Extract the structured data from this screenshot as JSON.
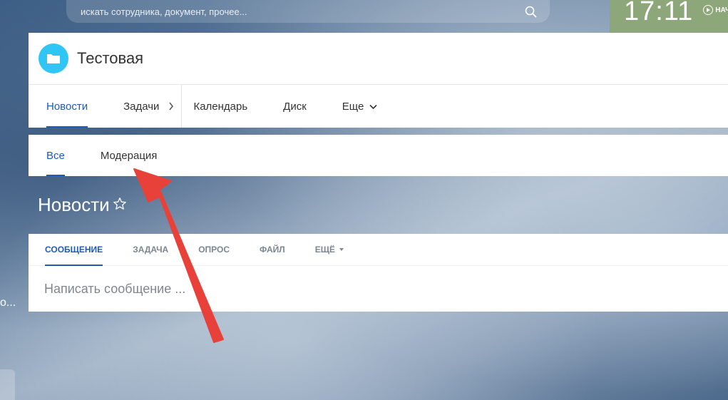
{
  "search": {
    "placeholder": "искать сотрудника, документ, прочее..."
  },
  "clock": {
    "time": "17:11",
    "start_label": "НАЧ"
  },
  "group": {
    "title": "Тестовая"
  },
  "main_nav": {
    "items": [
      {
        "label": "Новости",
        "active": true
      },
      {
        "label": "Задачи"
      },
      {
        "label": "Календарь"
      },
      {
        "label": "Диск"
      },
      {
        "label": "Еще"
      }
    ]
  },
  "sub_nav": {
    "items": [
      {
        "label": "Все",
        "active": true
      },
      {
        "label": "Модерация"
      }
    ]
  },
  "page": {
    "title": "Новости"
  },
  "post_form": {
    "tabs": [
      {
        "label": "СООБЩЕНИЕ",
        "active": true
      },
      {
        "label": "ЗАДАЧА"
      },
      {
        "label": "ОПРОС"
      },
      {
        "label": "ФАЙЛ"
      },
      {
        "label": "ЕЩЁ"
      }
    ],
    "placeholder": "Написать сообщение ..."
  },
  "left_fragment": {
    "text": "о..."
  },
  "colors": {
    "accent": "#1f5bb5",
    "group_avatar": "#2fc6f6",
    "clock_bg": "#8da67a",
    "annotation": "#e8413a"
  }
}
